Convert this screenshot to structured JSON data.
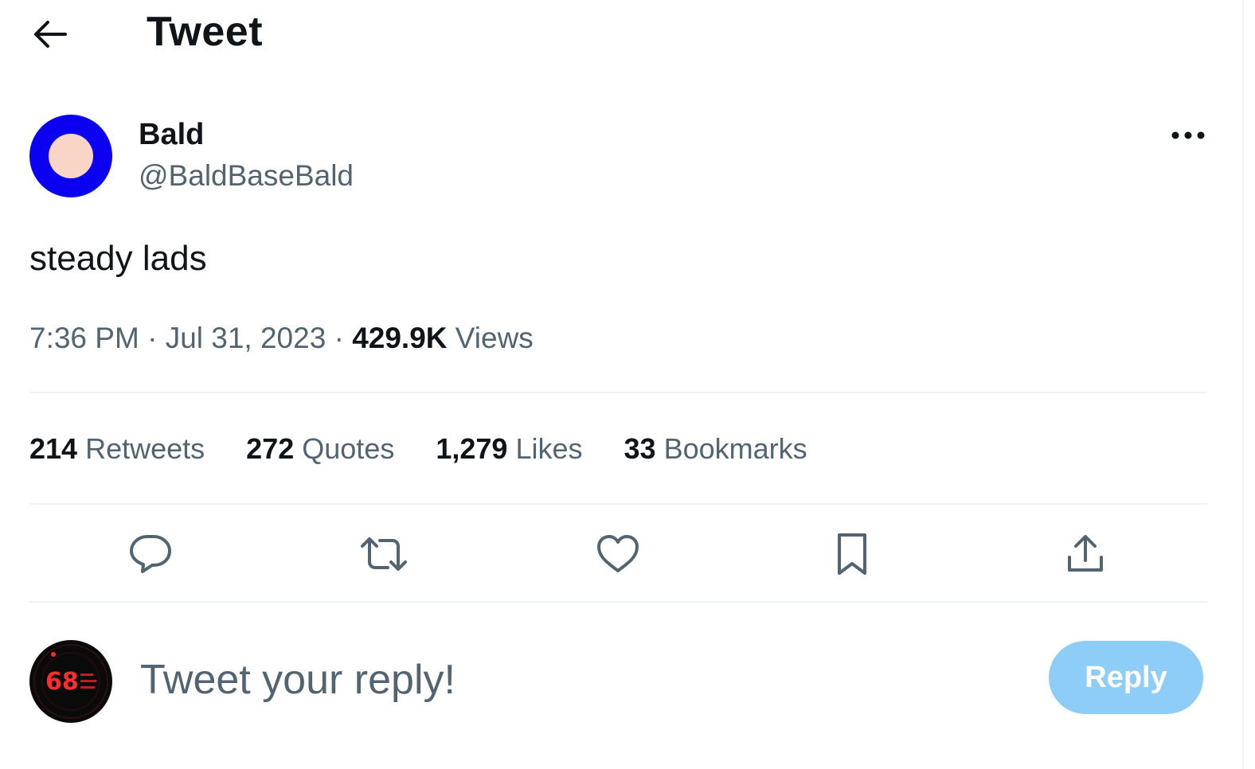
{
  "header": {
    "title": "Tweet",
    "back_icon": "arrow-left-icon"
  },
  "author": {
    "display_name": "Bald",
    "handle": "@BaldBaseBald",
    "avatar_colors": {
      "ring": "#0b00f0",
      "center": "#f8d5c6"
    }
  },
  "tweet": {
    "text": "steady lads",
    "time": "7:36 PM",
    "date": "Jul 31, 2023",
    "views_count": "429.9K",
    "views_label": "Views"
  },
  "stats": [
    {
      "count": "214",
      "label": "Retweets"
    },
    {
      "count": "272",
      "label": "Quotes"
    },
    {
      "count": "1,279",
      "label": "Likes"
    },
    {
      "count": "33",
      "label": "Bookmarks"
    }
  ],
  "actions": [
    "reply-icon",
    "retweet-icon",
    "like-icon",
    "bookmark-icon",
    "share-icon"
  ],
  "composer": {
    "placeholder": "Tweet your reply!",
    "button_label": "Reply",
    "button_color": "#8ecdf8",
    "avatar_text": "68"
  },
  "colors": {
    "text_primary": "#0f1419",
    "text_secondary": "#536471",
    "divider": "#eff3f4",
    "icon": "#536471"
  }
}
